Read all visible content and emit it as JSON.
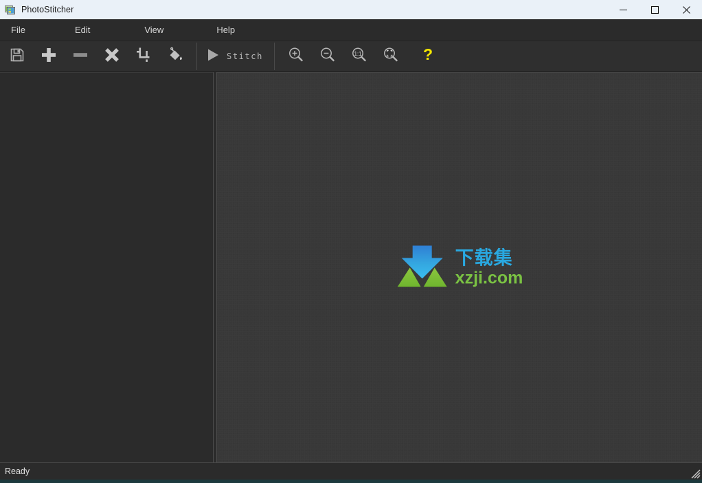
{
  "window": {
    "title": "PhotoStitcher",
    "app_icon": "photo-stack-icon",
    "controls": {
      "minimize": "minimize-icon",
      "maximize": "maximize-icon",
      "close": "close-icon"
    }
  },
  "menubar": {
    "items": [
      {
        "label": "File"
      },
      {
        "label": "Edit"
      },
      {
        "label": "View"
      },
      {
        "label": "Help"
      }
    ]
  },
  "toolbar": {
    "buttons": [
      {
        "name": "save-button",
        "icon": "floppy-disk-icon",
        "tooltip": "Save"
      },
      {
        "name": "add-button",
        "icon": "plus-icon",
        "tooltip": "Add"
      },
      {
        "name": "remove-button",
        "icon": "minus-icon",
        "tooltip": "Remove"
      },
      {
        "name": "delete-button",
        "icon": "cross-icon",
        "tooltip": "Delete"
      },
      {
        "name": "crop-button",
        "icon": "crop-icon",
        "tooltip": "Crop"
      },
      {
        "name": "fill-button",
        "icon": "paint-bucket-icon",
        "tooltip": "Fill"
      }
    ],
    "stitch": {
      "label": "Stitch",
      "icon": "play-triangle-icon"
    },
    "view_buttons": [
      {
        "name": "zoom-in-button",
        "icon": "zoom-in-icon",
        "tooltip": "Zoom In"
      },
      {
        "name": "zoom-out-button",
        "icon": "zoom-out-icon",
        "tooltip": "Zoom Out"
      },
      {
        "name": "actual-size-button",
        "icon": "zoom-one-to-one-icon",
        "label": "1:1",
        "tooltip": "Actual Size"
      },
      {
        "name": "fit-window-button",
        "icon": "zoom-fit-icon",
        "tooltip": "Fit to Window"
      }
    ],
    "help": {
      "name": "help-button",
      "icon": "question-mark-icon",
      "label": "?",
      "color": "#f5e800"
    }
  },
  "panels": {
    "image_list": {
      "name": "image-list-panel",
      "items": []
    },
    "canvas": {
      "name": "preview-canvas",
      "background_color": "#383838",
      "watermark": {
        "chinese_text": "下载集",
        "domain_text": "xzji.com",
        "arrow_color": "#29a8e0",
        "wing_color": "#7ac143"
      }
    }
  },
  "statusbar": {
    "text": "Ready",
    "grip": "resize-grip-icon"
  },
  "colors": {
    "titlebar_bg": "#eaf1f8",
    "chrome_bg": "#2b2b2b",
    "toolbar_bg": "#2f2f2f",
    "canvas_bg": "#383838",
    "accent_yellow": "#f5e800"
  }
}
